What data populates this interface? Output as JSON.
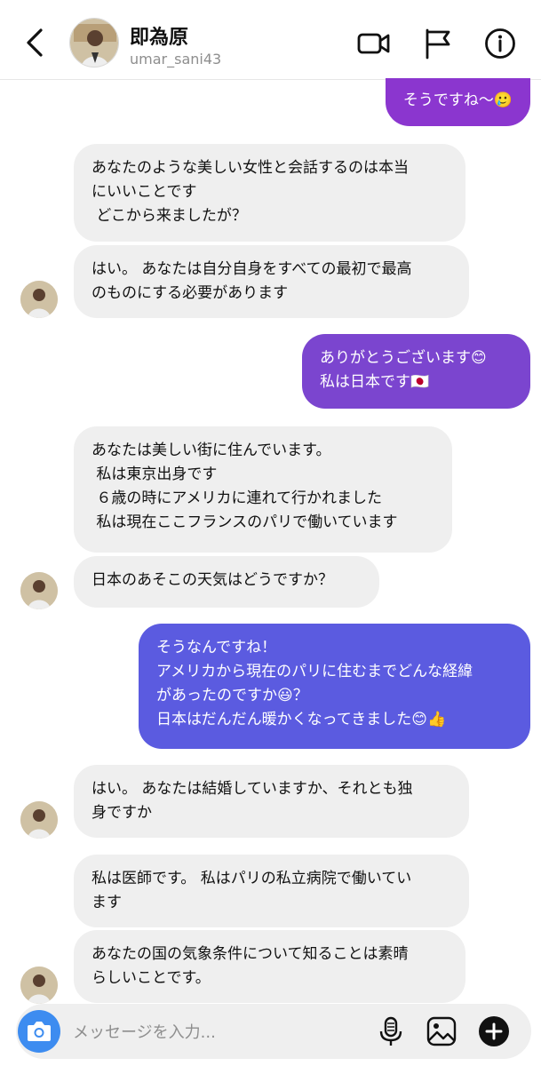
{
  "header": {
    "name": "即為原",
    "username": "umar_sani43"
  },
  "messages": [
    {
      "dir": "out",
      "text": "そうですね〜🥲"
    },
    {
      "dir": "in",
      "text": "あなたのような美しい女性と会話するのは本当\nにいいことです\n どこから来ましたが？"
    },
    {
      "dir": "in",
      "text": "はい。 あなたは自分自身をすべての最初で最高\nのものにする必要があります"
    },
    {
      "dir": "out",
      "text": "ありがとうございます😊\n私は日本です🇯🇵"
    },
    {
      "dir": "in",
      "text": "あなたは美しい街に住んでいます。\n 私は東京出身です\n ６歳の時にアメリカに連れて行かれました\n 私は現在ここフランスのパリで働いています"
    },
    {
      "dir": "in",
      "text": "日本のあそこの天気はどうですか？"
    },
    {
      "dir": "out",
      "text": "そうなんですね！\nアメリカから現在のパリに住むまでどんな経緯\nがあったのですか😃？\n日本はだんだん暖かくなってきました😊👍"
    },
    {
      "dir": "in",
      "text": "はい。 あなたは結婚していますか、それとも独\n身ですか"
    },
    {
      "dir": "in",
      "text": "私は医師です。 私はパリの私立病院で働いてい\nます"
    },
    {
      "dir": "in",
      "text": "あなたの国の気象条件について知ることは素晴\nらしいことです。"
    }
  ],
  "composer": {
    "placeholder": "メッセージを入力..."
  },
  "icons": {
    "back": "chevron-left-icon",
    "video": "video-call-icon",
    "flag": "flag-icon",
    "info": "info-icon",
    "camera": "camera-icon",
    "mic": "microphone-icon",
    "gallery": "image-icon",
    "add": "plus-icon"
  },
  "colors": {
    "incoming_bubble": "#efefef",
    "outgoing_top": "#8b36cf",
    "outgoing_middle": "#7b45cf",
    "outgoing_bottom": "#5b5be0",
    "camera_button": "#3d8cf0"
  }
}
